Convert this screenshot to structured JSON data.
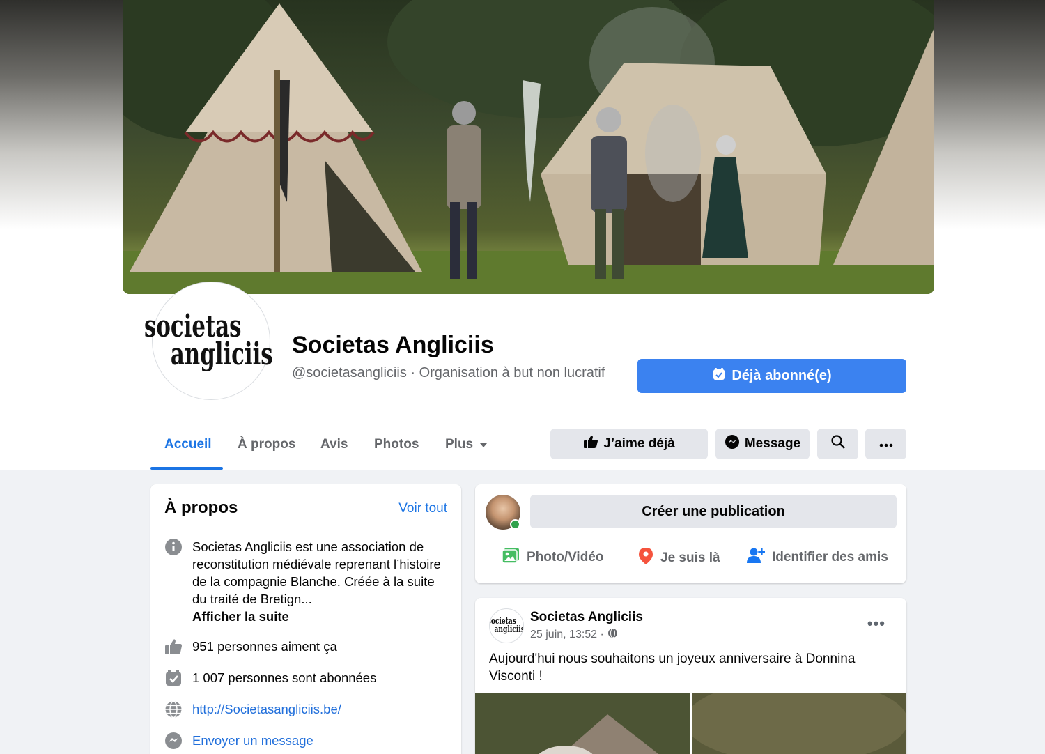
{
  "page": {
    "name": "Societas Angliciis",
    "handle_category": "@societasangliciis · Organisation à but non lucratif",
    "logo_text_line1": "societas",
    "logo_text_line2": "angliciis"
  },
  "subscribe_button": "Déjà abonné(e)",
  "tabs": [
    {
      "label": "Accueil",
      "active": true
    },
    {
      "label": "À propos"
    },
    {
      "label": "Avis"
    },
    {
      "label": "Photos"
    },
    {
      "label": "Plus"
    }
  ],
  "actions": {
    "like": "J’aime déjà",
    "message": "Message"
  },
  "about": {
    "title": "À propos",
    "see_all": "Voir tout",
    "description": "Societas Angliciis est une association de reconstitution médiévale reprenant l’histoire de la compagnie Blanche. Créée à la suite du traité de Bretign...",
    "show_more": "Afficher la suite",
    "likes": "951 personnes aiment ça",
    "followers": "1 007 personnes sont abonnées",
    "website": "http://Societasangliciis.be/",
    "send_message": "Envoyer un message"
  },
  "composer": {
    "placeholder": "Créer une publication",
    "photo_video": "Photo/Vidéo",
    "checkin": "Je suis là",
    "tag_friends": "Identifier des amis"
  },
  "post": {
    "author": "Societas Angliciis",
    "date": "25 juin, 13:52 ·",
    "text": "Aujourd'hui nous souhaitons un joyeux anniversaire à Donnina Visconti !",
    "more": "•••"
  },
  "colors": {
    "accent": "#1b74e4",
    "subscribe_bg": "#3b82f0",
    "button_bg": "#e4e6eb",
    "page_bg": "#f0f2f5",
    "online": "#31a24c"
  }
}
